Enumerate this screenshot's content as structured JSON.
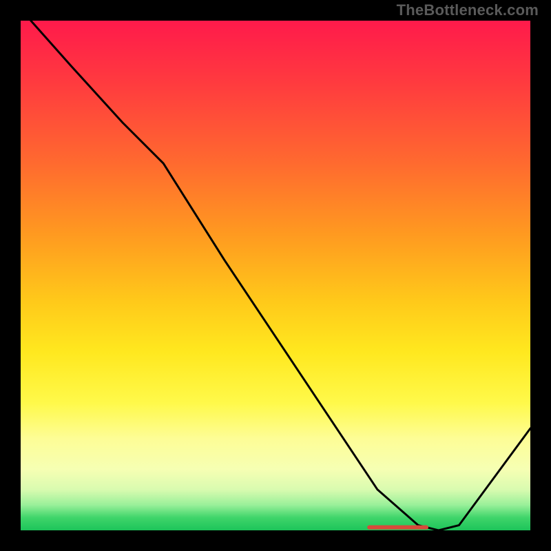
{
  "watermark": "TheBottleneck.com",
  "chart_data": {
    "type": "line",
    "title": "",
    "xlabel": "",
    "ylabel": "",
    "xlim": [
      0,
      100
    ],
    "ylim": [
      0,
      100
    ],
    "line": {
      "x": [
        2,
        10,
        20,
        28,
        40,
        50,
        60,
        70,
        78,
        82,
        86,
        100
      ],
      "y": [
        100,
        91,
        80,
        72,
        53,
        38,
        23,
        8,
        1,
        0,
        1,
        20
      ]
    },
    "optimal_marker": {
      "label": "",
      "color": "#d84a3a",
      "x_start": 68,
      "x_end": 80,
      "y": 0.6
    },
    "gradient_stops_pct": {
      "red": 0,
      "orange": 40,
      "yellow": 70,
      "pale": 88,
      "green": 100
    }
  }
}
